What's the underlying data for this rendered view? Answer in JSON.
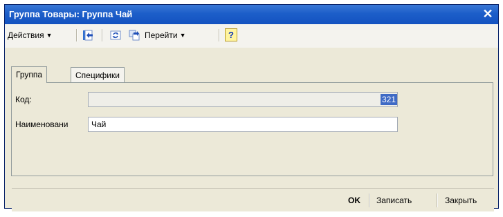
{
  "window": {
    "title": "Группа Товары: Группа Чай",
    "close_symbol": "✕"
  },
  "toolbar": {
    "actions_label": "Действия",
    "goto_label": "Перейти",
    "help_symbol": "?",
    "icons": [
      "move-left-icon",
      "refresh-icon",
      "switch-icon"
    ]
  },
  "tabs": [
    {
      "label": "Группа",
      "active": true
    },
    {
      "label": "Специфики",
      "active": false
    }
  ],
  "form": {
    "code_label": "Код:",
    "code_value": "321",
    "name_label": "Наименовани",
    "name_value": "Чай"
  },
  "buttons": {
    "ok": "OK",
    "save": "Записать",
    "close": "Закрыть"
  },
  "colors": {
    "titlebar": "#1c5ec9",
    "selection": "#3f6ac5"
  }
}
